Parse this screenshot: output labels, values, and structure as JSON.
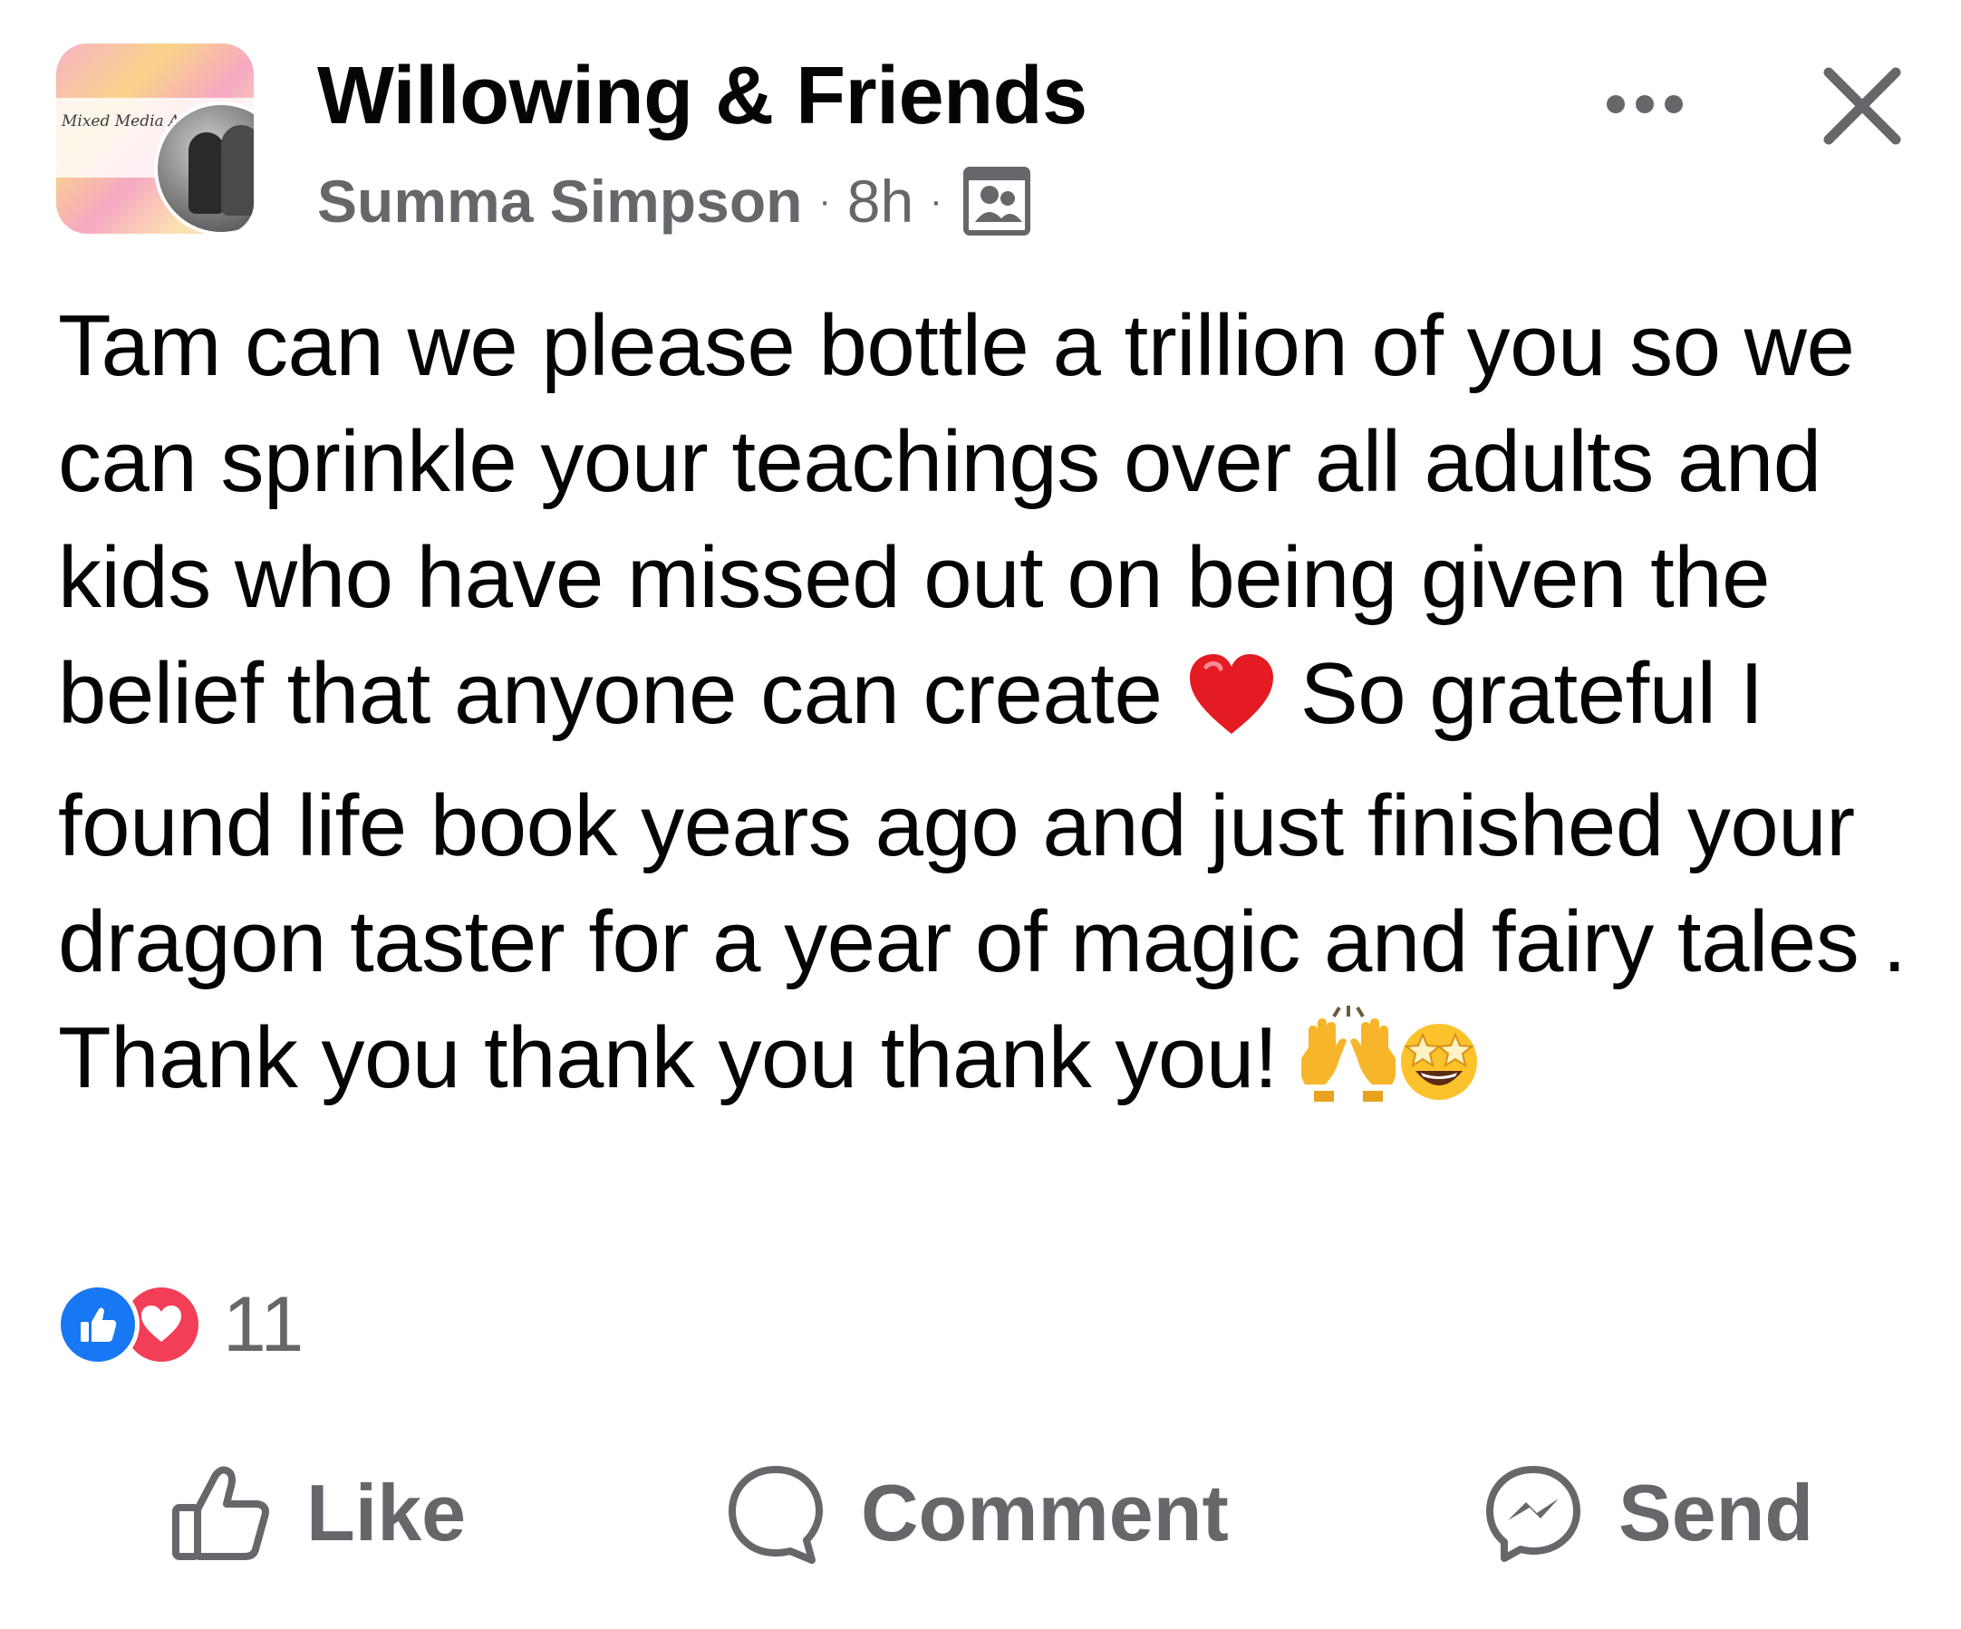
{
  "header": {
    "group_name": "Willowing & Friends",
    "author": "Summa Simpson",
    "separator": "·",
    "time": "8h",
    "audience_icon": "group-members-icon",
    "more_icon": "more-options-icon",
    "close_icon": "close-icon",
    "avatar_logo_text": "Mixed Media A"
  },
  "post": {
    "text_part1": "Tam can we please bottle a trillion of you so we can sprinkle your teachings over all adults and kids who have missed out on being given the belief that anyone can create ",
    "emoji_heart": "red-heart-emoji",
    "text_part2": " So grateful I found life book years ago and just finished your dragon taster for a year of magic and fairy tales . Thank you thank you thank you! ",
    "emoji_hands": "raising-hands-emoji",
    "emoji_star": "star-struck-emoji"
  },
  "reactions": {
    "types": [
      "like",
      "love"
    ],
    "count": "11",
    "colors": {
      "like": "#1877f2",
      "love": "#f33e58"
    }
  },
  "actions": {
    "like_label": "Like",
    "comment_label": "Comment",
    "send_label": "Send"
  },
  "colors": {
    "text": "#050505",
    "secondary": "#65676b",
    "background": "#ffffff"
  }
}
